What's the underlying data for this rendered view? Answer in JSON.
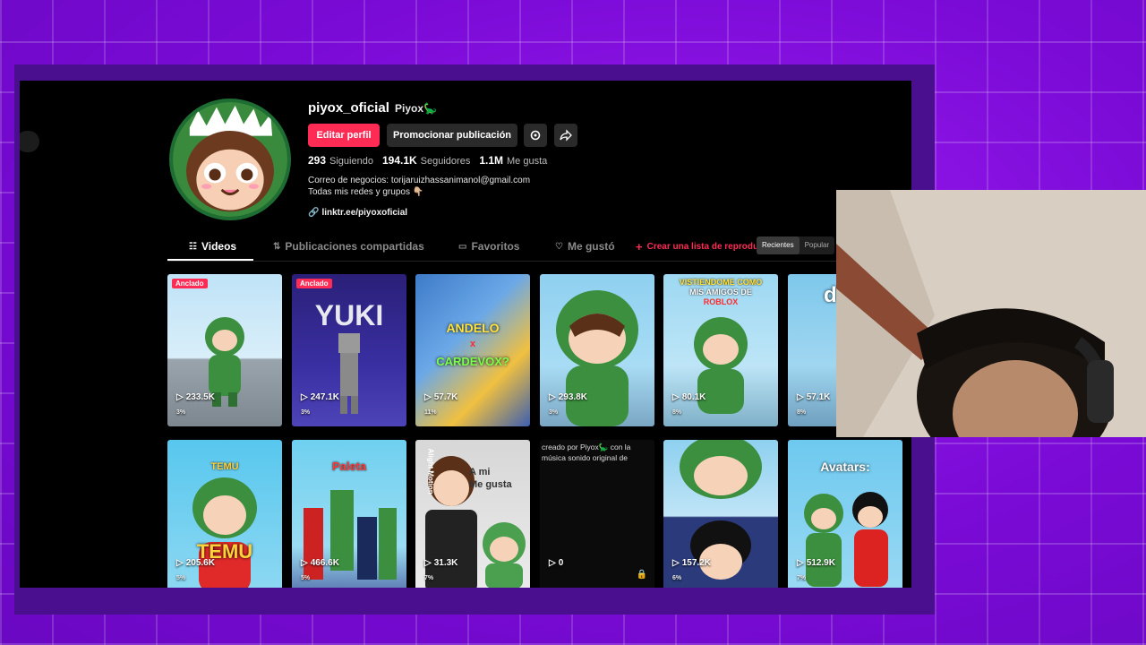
{
  "profile": {
    "username": "piyox_oficial",
    "nickname": "Piyox🦕",
    "edit_label": "Editar perfil",
    "promote_label": "Promocionar publicación",
    "following_count": "293",
    "following_label": "Siguiendo",
    "followers_count": "194.1K",
    "followers_label": "Seguidores",
    "likes_count": "1.1M",
    "likes_label": "Me gusta",
    "bio_line1": "Correo de negocios: torijaruizhassanimanol@gmail.com",
    "bio_line2": "Todas mis redes y grupos 👇🏼",
    "link": "linktr.ee/piyoxoficial"
  },
  "tabs": {
    "videos": "Videos",
    "reposts": "Publicaciones compartidas",
    "favorites": "Favoritos",
    "liked": "Me gustó",
    "create_playlist": "Crear una lista de reproducción",
    "sort_recent": "Recientes",
    "sort_popular": "Popular"
  },
  "videos": [
    {
      "badge": "Anclado",
      "views": "233.5K",
      "pct": "3%",
      "overlay": ""
    },
    {
      "badge": "Anclado",
      "views": "247.1K",
      "pct": "3%",
      "overlay": "YUKI"
    },
    {
      "badge": "",
      "views": "57.7K",
      "pct": "11%",
      "overlay": "ANDELO",
      "overlay2": "x",
      "overlay3": "CARDEVOX?"
    },
    {
      "badge": "",
      "views": "293.8K",
      "pct": "3%",
      "overlay": ""
    },
    {
      "badge": "",
      "views": "80.1K",
      "pct": "8%",
      "overlay": "VISTIENDOME COMO",
      "overlay2": "MIS AMIGOS DE",
      "overlay3": "ROBLOX"
    },
    {
      "badge": "",
      "views": "57.1K",
      "pct": "8%",
      "overlay": "d"
    },
    {
      "badge": "",
      "views": "205.6K",
      "pct": "5%",
      "overlay": "TEMU",
      "overlay2": "TEMU"
    },
    {
      "badge": "",
      "views": "466.6K",
      "pct": "5%",
      "overlay": "Paleta"
    },
    {
      "badge": "",
      "views": "31.3K",
      "pct": "7%",
      "overlay": "A mi",
      "overlay2": "Me gusta",
      "overlay3": "Alight Motion"
    },
    {
      "badge": "",
      "views": "0",
      "pct": "",
      "overlay": "",
      "alt": "creado por Piyox🦕 con la música sonido original de"
    },
    {
      "badge": "",
      "views": "157.2K",
      "pct": "6%",
      "overlay": ""
    },
    {
      "badge": "",
      "views": "512.9K",
      "pct": "7%",
      "overlay": "Avatars:"
    }
  ],
  "colors": {
    "accent": "#fe2c55",
    "background": "#000000",
    "stream_bg": "#7a0ad6"
  }
}
